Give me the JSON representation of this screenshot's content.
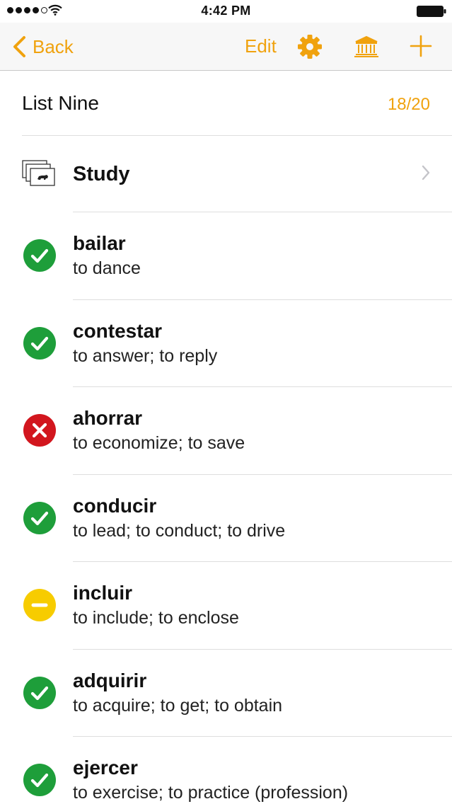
{
  "status_bar": {
    "time": "4:42 PM",
    "signal_dots_filled": 4,
    "signal_dots_total": 5,
    "icons": [
      "signal-dots",
      "wifi-icon",
      "battery-icon"
    ]
  },
  "nav": {
    "back_label": "Back",
    "edit_label": "Edit",
    "icons": [
      "chevron-left-icon",
      "gear-icon",
      "bank-icon",
      "plus-icon"
    ],
    "accent_color": "#f0a20e"
  },
  "list": {
    "title": "List Nine",
    "count": "18/20"
  },
  "study": {
    "label": "Study",
    "icon": "flashcards-icon"
  },
  "words": [
    {
      "word": "bailar",
      "definition": "to dance",
      "status": "correct"
    },
    {
      "word": "contestar",
      "definition": "to answer; to reply",
      "status": "correct"
    },
    {
      "word": "ahorrar",
      "definition": "to economize; to save",
      "status": "incorrect"
    },
    {
      "word": "conducir",
      "definition": "to lead; to conduct; to drive",
      "status": "correct"
    },
    {
      "word": "incluir",
      "definition": "to include; to enclose",
      "status": "partial"
    },
    {
      "word": "adquirir",
      "definition": "to acquire; to get; to obtain",
      "status": "correct"
    },
    {
      "word": "ejercer",
      "definition": "to exercise; to practice (profession)",
      "status": "correct"
    }
  ],
  "status_colors": {
    "correct": "#1e9e3a",
    "incorrect": "#d2161e",
    "partial": "#f7cc00"
  }
}
